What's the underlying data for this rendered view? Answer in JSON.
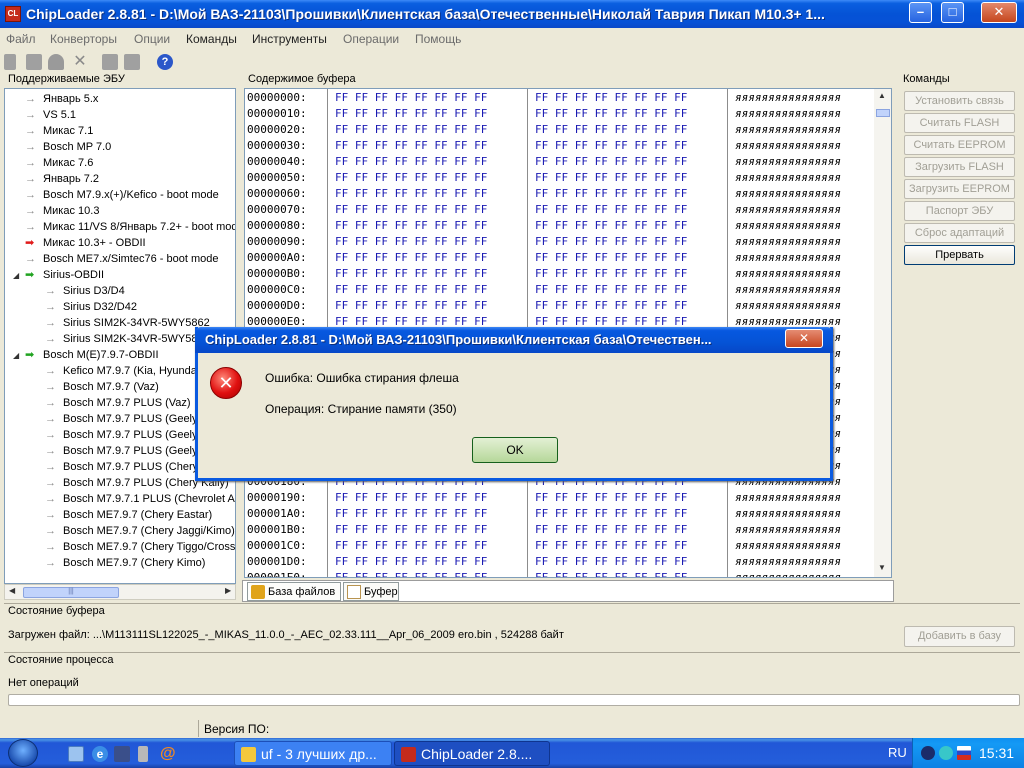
{
  "window": {
    "icon_text": "CL",
    "title": "ChipLoader 2.8.81 - D:\\Мой ВАЗ-21103\\Прошивки\\Клиентская база\\Отечественные\\Николай Таврия Пикап М10.3+ 1...",
    "min_label": "–",
    "max_label": "□",
    "close_label": "✕"
  },
  "menu": [
    {
      "label": "Файл",
      "enabled": false
    },
    {
      "label": "Конверторы",
      "enabled": false
    },
    {
      "label": "Опции",
      "enabled": false
    },
    {
      "label": "Команды",
      "enabled": true
    },
    {
      "label": "Инструменты",
      "enabled": true
    },
    {
      "label": "Операции",
      "enabled": false
    },
    {
      "label": "Помощь",
      "enabled": false
    }
  ],
  "toolbar": {
    "icons": [
      "pin-icon",
      "save-icon",
      "undo-icon",
      "cut-icon",
      "copy-icon",
      "paste-icon",
      "help-icon"
    ],
    "help_label": "?"
  },
  "left_panel": {
    "caption": "Поддерживаемые ЭБУ",
    "items": [
      {
        "label": "Январь 5.x",
        "indent": 1,
        "icon": "gray"
      },
      {
        "label": "VS 5.1",
        "indent": 1,
        "icon": "gray"
      },
      {
        "label": "Микас 7.1",
        "indent": 1,
        "icon": "gray"
      },
      {
        "label": "Bosch MP 7.0",
        "indent": 1,
        "icon": "gray"
      },
      {
        "label": "Микас 7.6",
        "indent": 1,
        "icon": "gray"
      },
      {
        "label": "Январь 7.2",
        "indent": 1,
        "icon": "gray"
      },
      {
        "label": "Bosch M7.9.x(+)/Kefico - boot mode",
        "indent": 1,
        "icon": "gray"
      },
      {
        "label": "Микас 10.3",
        "indent": 1,
        "icon": "gray"
      },
      {
        "label": "Микас 11/VS 8/Январь 7.2+ - boot mode",
        "indent": 1,
        "icon": "gray"
      },
      {
        "label": "Микас 10.3+ - OBDII",
        "indent": 1,
        "icon": "red"
      },
      {
        "label": "Bosch ME7.x/Simtec76 - boot mode",
        "indent": 1,
        "icon": "gray"
      },
      {
        "label": "Sirius-OBDII",
        "indent": 1,
        "icon": "green",
        "expander": "◢"
      },
      {
        "label": "Sirius D3/D4",
        "indent": 2,
        "icon": "gray"
      },
      {
        "label": "Sirius D32/D42",
        "indent": 2,
        "icon": "gray"
      },
      {
        "label": "Sirius SIM2K-34VR-5WY5862",
        "indent": 2,
        "icon": "gray"
      },
      {
        "label": "Sirius SIM2K-34VR-5WY58",
        "indent": 2,
        "icon": "gray"
      },
      {
        "label": "Bosch M(E)7.9.7-OBDII",
        "indent": 1,
        "icon": "green",
        "expander": "◢"
      },
      {
        "label": "Kefico M7.9.7 (Kia, Hyundai)",
        "indent": 2,
        "icon": "gray"
      },
      {
        "label": "Bosch M7.9.7 (Vaz)",
        "indent": 2,
        "icon": "gray"
      },
      {
        "label": "Bosch M7.9.7 PLUS (Vaz)",
        "indent": 2,
        "icon": "gray"
      },
      {
        "label": "Bosch M7.9.7 PLUS (Geely)",
        "indent": 2,
        "icon": "gray"
      },
      {
        "label": "Bosch M7.9.7 PLUS (Geely)",
        "indent": 2,
        "icon": "gray"
      },
      {
        "label": "Bosch M7.9.7 PLUS (Geely)",
        "indent": 2,
        "icon": "gray"
      },
      {
        "label": "Bosch M7.9.7 PLUS (Chery)",
        "indent": 2,
        "icon": "gray"
      },
      {
        "label": "Bosch M7.9.7 PLUS (Chery Kally)",
        "indent": 2,
        "icon": "gray"
      },
      {
        "label": "Bosch M7.9.7.1 PLUS (Chevrolet A",
        "indent": 2,
        "icon": "gray"
      },
      {
        "label": "Bosch ME7.9.7 (Chery Eastar)",
        "indent": 2,
        "icon": "gray"
      },
      {
        "label": "Bosch ME7.9.7 (Chery Jaggi/Kimo)",
        "indent": 2,
        "icon": "gray"
      },
      {
        "label": "Bosch ME7.9.7 (Chery Tiggo/Cross",
        "indent": 2,
        "icon": "gray"
      },
      {
        "label": "Bosch ME7.9.7 (Chery Kimo)",
        "indent": 2,
        "icon": "gray"
      }
    ],
    "scroll_left": "◀",
    "scroll_right": "▶",
    "scroll_grip": "|||"
  },
  "buffer": {
    "caption": "Содержимое буфера",
    "bytes_left": "FF FF FF FF FF FF FF FF",
    "bytes_right": "FF FF FF FF FF FF FF FF",
    "ascii": "яяяяяяяяяяяяяяяя",
    "rows": [
      "00000000:",
      "00000010:",
      "00000020:",
      "00000030:",
      "00000040:",
      "00000050:",
      "00000060:",
      "00000070:",
      "00000080:",
      "00000090:",
      "000000A0:",
      "000000B0:",
      "000000C0:",
      "000000D0:",
      "000000E0:",
      "000000F0:",
      "00000100:",
      "00000110:",
      "00000120:",
      "00000130:",
      "00000140:",
      "00000150:",
      "00000160:",
      "00000170:",
      "00000180:",
      "00000190:",
      "000001A0:",
      "000001B0:",
      "000001C0:",
      "000001D0:",
      "000001E0:"
    ],
    "scroll_up": "▲",
    "scroll_down": "▼",
    "tabs": [
      {
        "label": "База файлов"
      },
      {
        "label": "Буфер"
      }
    ]
  },
  "commands": {
    "caption": "Команды",
    "buttons": [
      {
        "label": "Установить связь",
        "enabled": false
      },
      {
        "label": "Считать FLASH",
        "enabled": false
      },
      {
        "label": "Считать EEPROM",
        "enabled": false
      },
      {
        "label": "Загрузить FLASH",
        "enabled": false
      },
      {
        "label": "Загрузить EEPROM",
        "enabled": false
      },
      {
        "label": "Паспорт ЭБУ",
        "enabled": false
      },
      {
        "label": "Сброс адаптаций",
        "enabled": false
      },
      {
        "label": "Прервать",
        "enabled": true
      }
    ]
  },
  "buffer_state": {
    "caption": "Состояние буфера",
    "loaded_file": "Загружен файл: ...\\M113111SL122025_-_MIKAS_11.0.0_-_AEC_02.33.111__Apr_06_2009 ero.bin , 524288 байт",
    "add_button": "Добавить в базу"
  },
  "process_state": {
    "caption": "Состояние процесса",
    "status": "Нет операций"
  },
  "statusbar": {
    "version_label": "Версия ПО:"
  },
  "dialog": {
    "title": "ChipLoader 2.8.81 - D:\\Мой ВАЗ-21103\\Прошивки\\Клиентская база\\Отечествен...",
    "close_label": "✕",
    "error_icon_label": "✕",
    "error_line": "Ошибка: Ошибка стирания флеша",
    "operation_line": "Операция: Стирание памяти (350)",
    "ok_label": "OK"
  },
  "taskbar": {
    "quicklaunch": [
      "show-desktop-icon",
      "ie-icon",
      "floppy-icon",
      "tool-icon",
      "at-icon"
    ],
    "tasks": [
      {
        "label": "uf - 3 лучших др..."
      },
      {
        "label": "ChipLoader 2.8...."
      }
    ],
    "lang": "RU",
    "clock": "15:31"
  }
}
